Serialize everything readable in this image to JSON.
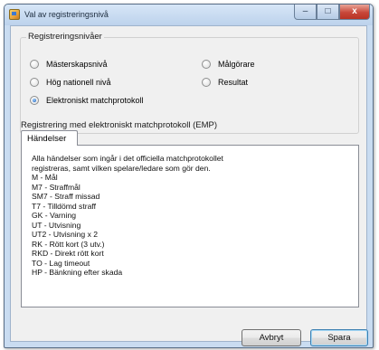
{
  "window": {
    "title": "Val av registreringsnivå"
  },
  "titlebar_buttons": {
    "minimize": "–",
    "maximize": "□",
    "close": "x"
  },
  "levels_group": {
    "title": "Registreringsnivåer",
    "options": [
      {
        "label": "Mästerskapsnivå",
        "checked": false
      },
      {
        "label": "Hög nationell nivå",
        "checked": false
      },
      {
        "label": "Elektroniskt matchprotokoll",
        "checked": true
      },
      {
        "label": "Målgörare",
        "checked": false
      },
      {
        "label": "Resultat",
        "checked": false
      }
    ]
  },
  "emp_section": {
    "title": "Registrering med elektroniskt matchprotokoll (EMP)",
    "tab_label": "Händelser",
    "lines": [
      "Alla händelser som ingår i det officiella matchprotokollet registreras, samt vilken spelare/ledare som gör den.",
      "M - Mål",
      "M7 - Straffmål",
      "SM7 - Straff missad",
      "T7 - Tilldömd straff",
      "GK - Varning",
      "UT - Utvisning",
      "UT2 - Utvisning x 2",
      "RK - Rött kort (3 utv.)",
      "RKD - Direkt rött kort",
      "TO - Lag timeout",
      "HP - Bänkning efter skada"
    ]
  },
  "buttons": {
    "cancel": "Avbryt",
    "save": "Spara"
  }
}
